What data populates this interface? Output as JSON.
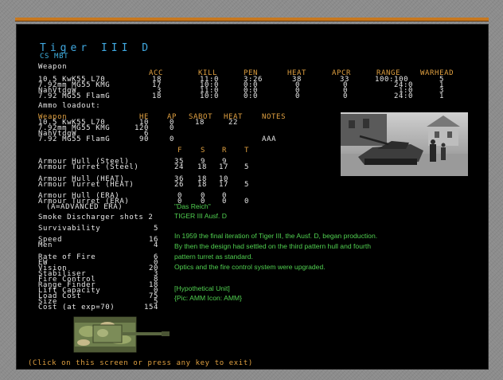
{
  "unit": {
    "name": "Tiger III D",
    "type": "CS MBT"
  },
  "weapons": {
    "section_label": "Weapon",
    "headers": [
      "ACC",
      "KILL",
      "PEN",
      "HEAT",
      "APCR",
      "RANGE",
      "WARHEAD"
    ],
    "rows": [
      {
        "name": "10.5 KwK55 L70",
        "acc": "18",
        "kill": "11:0",
        "pen": "3:26",
        "heat": "38",
        "apcr": "33",
        "range": "100:100",
        "warhead": "5"
      },
      {
        "name": "7.92mm MG55 KMG",
        "acc": "17",
        "kill": "10:0",
        "pen": "0:0",
        "heat": "0",
        "apcr": "0",
        "range": "24:0",
        "warhead": "1"
      },
      {
        "name": "NahVtdgW",
        "acc": "3",
        "kill": "11:0",
        "pen": "0:0",
        "heat": "0",
        "apcr": "0",
        "range": "1:0",
        "warhead": "3"
      },
      {
        "name": "7.92 MG55 FlamG",
        "acc": "18",
        "kill": "10:0",
        "pen": "0:0",
        "heat": "0",
        "apcr": "0",
        "range": "24:0",
        "warhead": "1"
      }
    ]
  },
  "ammo": {
    "section_label": "Ammo loadout:",
    "headers": [
      "Weapon",
      "HE",
      "AP",
      "SABOT",
      "HEAT",
      "NOTES"
    ],
    "rows": [
      {
        "name": "10.5 KwK55 L70",
        "he": "10",
        "ap": "0",
        "sabot": "18",
        "heat": "22",
        "notes": ""
      },
      {
        "name": "7.92mm MG55 KMG",
        "he": "120",
        "ap": "0",
        "sabot": "",
        "heat": "",
        "notes": ""
      },
      {
        "name": "NahVtdgW",
        "he": "6",
        "ap": "",
        "sabot": "",
        "heat": "",
        "notes": ""
      },
      {
        "name": "7.92 MG55 FlamG",
        "he": "90",
        "ap": "0",
        "sabot": "",
        "heat": "",
        "notes": "AAA"
      }
    ]
  },
  "armour": {
    "headers": [
      "F",
      "S",
      "R",
      "T"
    ],
    "rows": [
      {
        "label": "Armour Hull (Steel)",
        "f": "35",
        "s": "9",
        "r": "9",
        "t": ""
      },
      {
        "label": "Armour Turret (Steel)",
        "f": "24",
        "s": "18",
        "r": "17",
        "t": "5"
      },
      {
        "label": "Armour Hull (HEAT)",
        "f": "36",
        "s": "18",
        "r": "10",
        "t": ""
      },
      {
        "label": "Armour Turret (HEAT)",
        "f": "26",
        "s": "18",
        "r": "17",
        "t": "5"
      },
      {
        "label": "Armour Hull (ERA)",
        "f": "0",
        "s": "0",
        "r": "0",
        "t": ""
      },
      {
        "label": "Armour Turret (ERA)",
        "f": "0",
        "s": "0",
        "r": "0",
        "t": "0"
      }
    ],
    "era_note": "(A=ADVANCED ERA)"
  },
  "smoke": "Smoke Discharger shots 2",
  "stats": [
    {
      "label": "Survivability",
      "value": "5"
    },
    {
      "label": "Speed",
      "value": "16"
    },
    {
      "label": "Men",
      "value": "4"
    },
    {
      "label": "Rate of Fire",
      "value": "6"
    },
    {
      "label": "EW",
      "value": "0"
    },
    {
      "label": "Vision",
      "value": "20"
    },
    {
      "label": "Stabiliser",
      "value": "3"
    },
    {
      "label": "Fire Control",
      "value": "8"
    },
    {
      "label": "Range Finder",
      "value": "18"
    },
    {
      "label": "Lift Capacity",
      "value": "0"
    },
    {
      "label": "Load Cost",
      "value": "75"
    },
    {
      "label": "Size",
      "value": "5"
    },
    {
      "label": "Cost (at exp=70)",
      "value": "154"
    }
  ],
  "info": {
    "formation": "\"Das Reich\"",
    "designation": "TIGER III Ausf. D",
    "description": [
      "In 1959 the final iteration of Tiger III, the Ausf. D, began production.",
      "By then the design had settled on the third pattern hull and fourth",
      "pattern turret as standard.",
      "Optics and the fire control system were upgraded."
    ],
    "hypothetical": "[Hypothetical Unit]",
    "credits": "{Pic: AMM Icon: AMM}"
  },
  "footer": "(Click on this screen or press any key to exit)",
  "colors": {
    "title": "#40a8e0",
    "header": "#e0a040",
    "text": "#e8e8e8",
    "info": "#50d050",
    "frame": "#8c8c8c",
    "accent_bar": "#c8781e"
  },
  "icons": [
    "unit-photo",
    "unit-map-icon"
  ]
}
